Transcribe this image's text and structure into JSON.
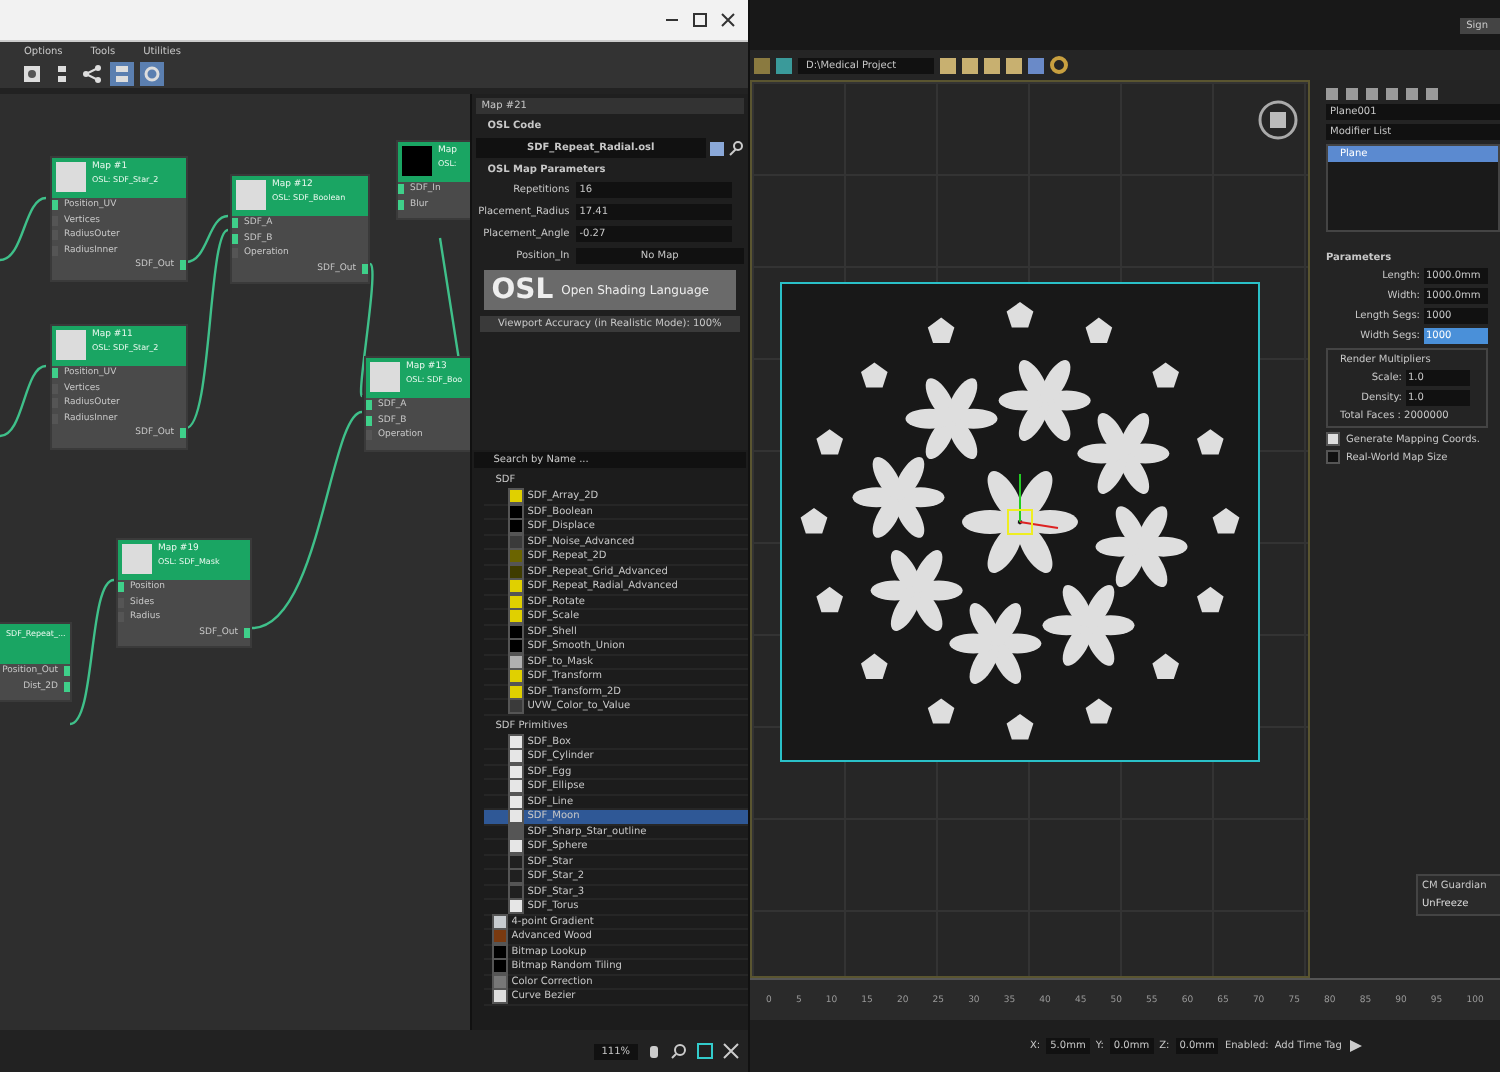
{
  "editor": {
    "menu": [
      "Options",
      "Tools",
      "Utilities"
    ],
    "nodes": [
      {
        "title": "Map #1",
        "subtitle": "OSL: SDF_Star_2",
        "color": "#dcdcdc",
        "inputs": [
          "Position_UV",
          "Vertices",
          "RadiusOuter",
          "RadiusInner"
        ],
        "outputs": [
          "SDF_Out"
        ]
      },
      {
        "title": "Map #12",
        "subtitle": "OSL: SDF_Boolean",
        "color": "#dcdcdc",
        "inputs": [
          "SDF_A",
          "SDF_B",
          "Operation"
        ],
        "outputs": [
          "SDF_Out"
        ]
      },
      {
        "title": "Map",
        "subtitle": "OSL:",
        "color": "#000000",
        "inputs": [
          "SDF_In",
          "Blur"
        ]
      },
      {
        "title": "Map #11",
        "subtitle": "OSL: SDF_Star_2",
        "color": "#dcdcdc",
        "inputs": [
          "Position_UV",
          "Vertices",
          "RadiusOuter",
          "RadiusInner"
        ],
        "outputs": [
          "SDF_Out"
        ]
      },
      {
        "title": "Map #13",
        "subtitle": "OSL: SDF_Boo",
        "color": "#dcdcdc",
        "inputs": [
          "SDF_A",
          "SDF_B",
          "Operation"
        ]
      },
      {
        "title": "Map #19",
        "subtitle": "OSL: SDF_Mask",
        "color": "#dcdcdc",
        "inputs": [
          "Position",
          "Sides",
          "Radius"
        ],
        "outputs": [
          "SDF_Out"
        ]
      },
      {
        "subtitle": "SDF_Repeat_...",
        "outputs": [
          "Position_Out",
          "Dist_2D"
        ]
      }
    ],
    "params": {
      "title": "Map #21",
      "code_rollout": "OSL Code",
      "code_file": "SDF_Repeat_Radial.osl",
      "map_rollout": "OSL Map Parameters",
      "rows": [
        {
          "label": "Repetitions",
          "value": "16"
        },
        {
          "label": "Placement_Radius",
          "value": "17.41"
        },
        {
          "label": "Placement_Angle",
          "value": "-0.27"
        }
      ],
      "map_label": "Position_In",
      "map_value": "No Map",
      "logo": "OSL",
      "logo_caption": "Open Shading Language",
      "accuracy": "Viewport Accuracy (in Realistic Mode): 100%"
    },
    "browser": {
      "search": "Search by Name ...",
      "groups": [
        {
          "name": "SDF",
          "items": [
            {
              "name": "SDF_Array_2D",
              "color": "#e0d000",
              "selected": false
            },
            {
              "name": "SDF_Boolean",
              "color": "#000000",
              "selected": false
            },
            {
              "name": "SDF_Displace",
              "color": "#000000",
              "selected": false
            },
            {
              "name": "SDF_Noise_Advanced",
              "color": "#3a3a3a",
              "selected": false
            },
            {
              "name": "SDF_Repeat_2D",
              "color": "#6b6400",
              "selected": false
            },
            {
              "name": "SDF_Repeat_Grid_Advanced",
              "color": "#3f3c00",
              "selected": false
            },
            {
              "name": "SDF_Repeat_Radial_Advanced",
              "color": "#e0d000",
              "selected": false
            },
            {
              "name": "SDF_Rotate",
              "color": "#e0d000",
              "selected": false
            },
            {
              "name": "SDF_Scale",
              "color": "#e0d000",
              "selected": false
            },
            {
              "name": "SDF_Shell",
              "color": "#000000",
              "selected": false
            },
            {
              "name": "SDF_Smooth_Union",
              "color": "#000000",
              "selected": false
            },
            {
              "name": "SDF_to_Mask",
              "color": "#b0b0b0",
              "selected": false
            },
            {
              "name": "SDF_Transform",
              "color": "#e0d000",
              "selected": false
            },
            {
              "name": "SDF_Transform_2D",
              "color": "#e0d000",
              "selected": false
            },
            {
              "name": "UVW_Color_to_Value",
              "color": "#3a3a3a",
              "selected": false
            }
          ]
        },
        {
          "name": "SDF Primitives",
          "items": [
            {
              "name": "SDF_Box",
              "color": "#e6e6e6",
              "selected": false
            },
            {
              "name": "SDF_Cylinder",
              "color": "#e6e6e6",
              "selected": false
            },
            {
              "name": "SDF_Egg",
              "color": "#e6e6e6",
              "selected": false
            },
            {
              "name": "SDF_Ellipse",
              "color": "#e6e6e6",
              "selected": false
            },
            {
              "name": "SDF_Line",
              "color": "#e6e6e6",
              "selected": false
            },
            {
              "name": "SDF_Moon",
              "color": "#e6e6e6",
              "selected": true
            },
            {
              "name": "SDF_Sharp_Star_outline",
              "color": "#555555",
              "selected": false
            },
            {
              "name": "SDF_Sphere",
              "color": "#e6e6e6",
              "selected": false
            },
            {
              "name": "SDF_Star",
              "color": "#202020",
              "selected": false
            },
            {
              "name": "SDF_Star_2",
              "color": "#202020",
              "selected": false
            },
            {
              "name": "SDF_Star_3",
              "color": "#202020",
              "selected": false
            },
            {
              "name": "SDF_Torus",
              "color": "#e6e6e6",
              "selected": false
            }
          ]
        }
      ],
      "maps": [
        {
          "name": "4-point Gradient",
          "color": "#c8ccd0"
        },
        {
          "name": "Advanced Wood",
          "color": "#7a3a10"
        },
        {
          "name": "Bitmap Lookup",
          "color": "#000000"
        },
        {
          "name": "Bitmap Random Tiling",
          "color": "#000000"
        },
        {
          "name": "Color Correction",
          "color": "#777777"
        },
        {
          "name": "Curve Bezier",
          "color": "#dddddd"
        }
      ]
    },
    "zoom": "111%"
  },
  "max": {
    "project": "D:\\Medical Project",
    "sign_in": "Sign",
    "object_name": "Plane001",
    "modifier_list": "Modifier List",
    "stack": [
      {
        "name": "Plane",
        "selected": true
      }
    ],
    "rollout": "Parameters",
    "fields": [
      {
        "label": "Length:",
        "value": "1000.0mm"
      },
      {
        "label": "Width:",
        "value": "1000.0mm"
      },
      {
        "label": "Length Segs:",
        "value": "1000",
        "selected": false
      },
      {
        "label": "Width Segs:",
        "value": "1000",
        "selected": true
      }
    ],
    "multipliers": "Render Multipliers",
    "mult_fields": [
      {
        "label": "Scale:",
        "value": "1.0"
      },
      {
        "label": "Density:",
        "value": "1.0"
      }
    ],
    "total_faces": "Total Faces : 2000000",
    "checks": [
      {
        "label": "Generate Mapping Coords.",
        "checked": true
      },
      {
        "label": "Real-World Map Size",
        "checked": false
      }
    ],
    "float_title": "CM Guardian",
    "float_button": "UnFreeze",
    "ticks": [
      "0",
      "5",
      "10",
      "15",
      "20",
      "25",
      "30",
      "35",
      "40",
      "45",
      "50",
      "55",
      "60",
      "65",
      "70",
      "75",
      "80",
      "85",
      "90",
      "95",
      "100"
    ],
    "coords": [
      {
        "axis": "X:",
        "value": "5.0mm"
      },
      {
        "axis": "Y:",
        "value": "0.0mm"
      },
      {
        "axis": "Z:",
        "value": "0.0mm"
      }
    ],
    "enabled": "Enabled:",
    "time_tag": "Add Time Tag"
  }
}
